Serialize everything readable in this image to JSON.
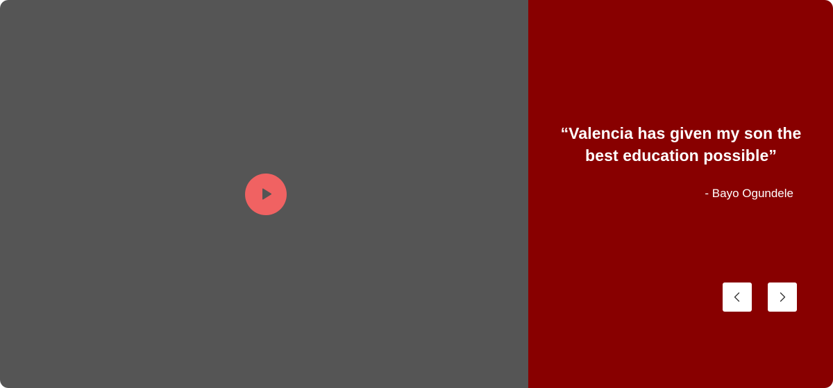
{
  "video": {
    "play_icon": "play-icon",
    "panel_color": "#555555",
    "play_color": "#f06262"
  },
  "testimonial": {
    "quote": "“Valencia has given my son the best education possible”",
    "author": "- Bayo Ogundele",
    "panel_color": "#880000"
  },
  "navigation": {
    "prev_icon": "chevron-left-icon",
    "next_icon": "chevron-right-icon"
  }
}
